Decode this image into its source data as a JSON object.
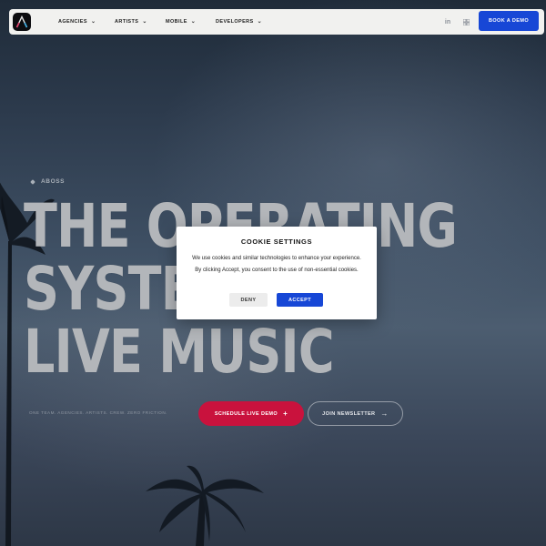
{
  "nav": {
    "items": [
      {
        "label": "AGENCIES"
      },
      {
        "label": "ARTISTS"
      },
      {
        "label": "MOBILE"
      },
      {
        "label": "DEVELOPERS"
      }
    ],
    "social": {
      "linkedin_glyph": "in",
      "linkedin_icon": "linkedin-icon",
      "grid_icon": "grid-icon"
    },
    "book_demo_label": "BOOK A DEMO",
    "logo_icon": "aboss-logo-icon",
    "chevron_glyph": "⌄"
  },
  "hero": {
    "eyebrow": "ABOSS",
    "headline": [
      "THE OPERATING",
      "SYSTEM FOR",
      "LIVE MUSIC"
    ],
    "subtext": "ONE TEAM. AGENCIES. ARTISTS. CREW. ZERO FRICTION.",
    "primary_cta": "SCHEDULE LIVE DEMO",
    "primary_cta_glyph": "+",
    "secondary_cta": "JOIN NEWSLETTER",
    "secondary_cta_glyph": "→"
  },
  "cookie": {
    "title": "COOKIE SETTINGS",
    "body": "We use cookies and similar technologies to enhance your experience. By clicking Accept, you consent to the use of non-essential cookies.",
    "deny_label": "DENY",
    "accept_label": "ACCEPT"
  },
  "colors": {
    "accent_blue": "#1747d6",
    "accent_red": "#c9123d",
    "hero_text": "#b3b6ba"
  }
}
